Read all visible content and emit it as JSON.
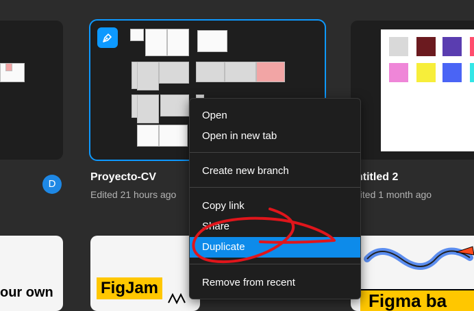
{
  "files": [
    {
      "title": "Proyecto-CV",
      "subtitle": "Edited 21 hours ago"
    },
    {
      "title": "ntitled 2",
      "subtitle": "dited 1 month ago"
    }
  ],
  "avatar": {
    "initial": "D",
    "color": "#1e88e5"
  },
  "context_menu": {
    "items": [
      {
        "label": "Open"
      },
      {
        "label": "Open in new tab"
      },
      {
        "label": "Create new branch"
      },
      {
        "label": "Copy link"
      },
      {
        "label": "Share"
      },
      {
        "label": "Duplicate",
        "active": true
      },
      {
        "label": "Remove from recent"
      }
    ]
  },
  "bottom_cards": {
    "left_text": "our own",
    "figjam_label": "FigJam",
    "right_text": "Figma ba"
  },
  "colors": {
    "accent": "#0d99ff",
    "highlight": "#0d8bea",
    "annotation_red": "#e0151b",
    "swatches": [
      "#d9d9d9",
      "#6b1a1f",
      "#5a3db0",
      "#ff4d6d",
      "#ef86d8",
      "#f7ee3a",
      "#4a64f5",
      "#33e6e6"
    ]
  }
}
